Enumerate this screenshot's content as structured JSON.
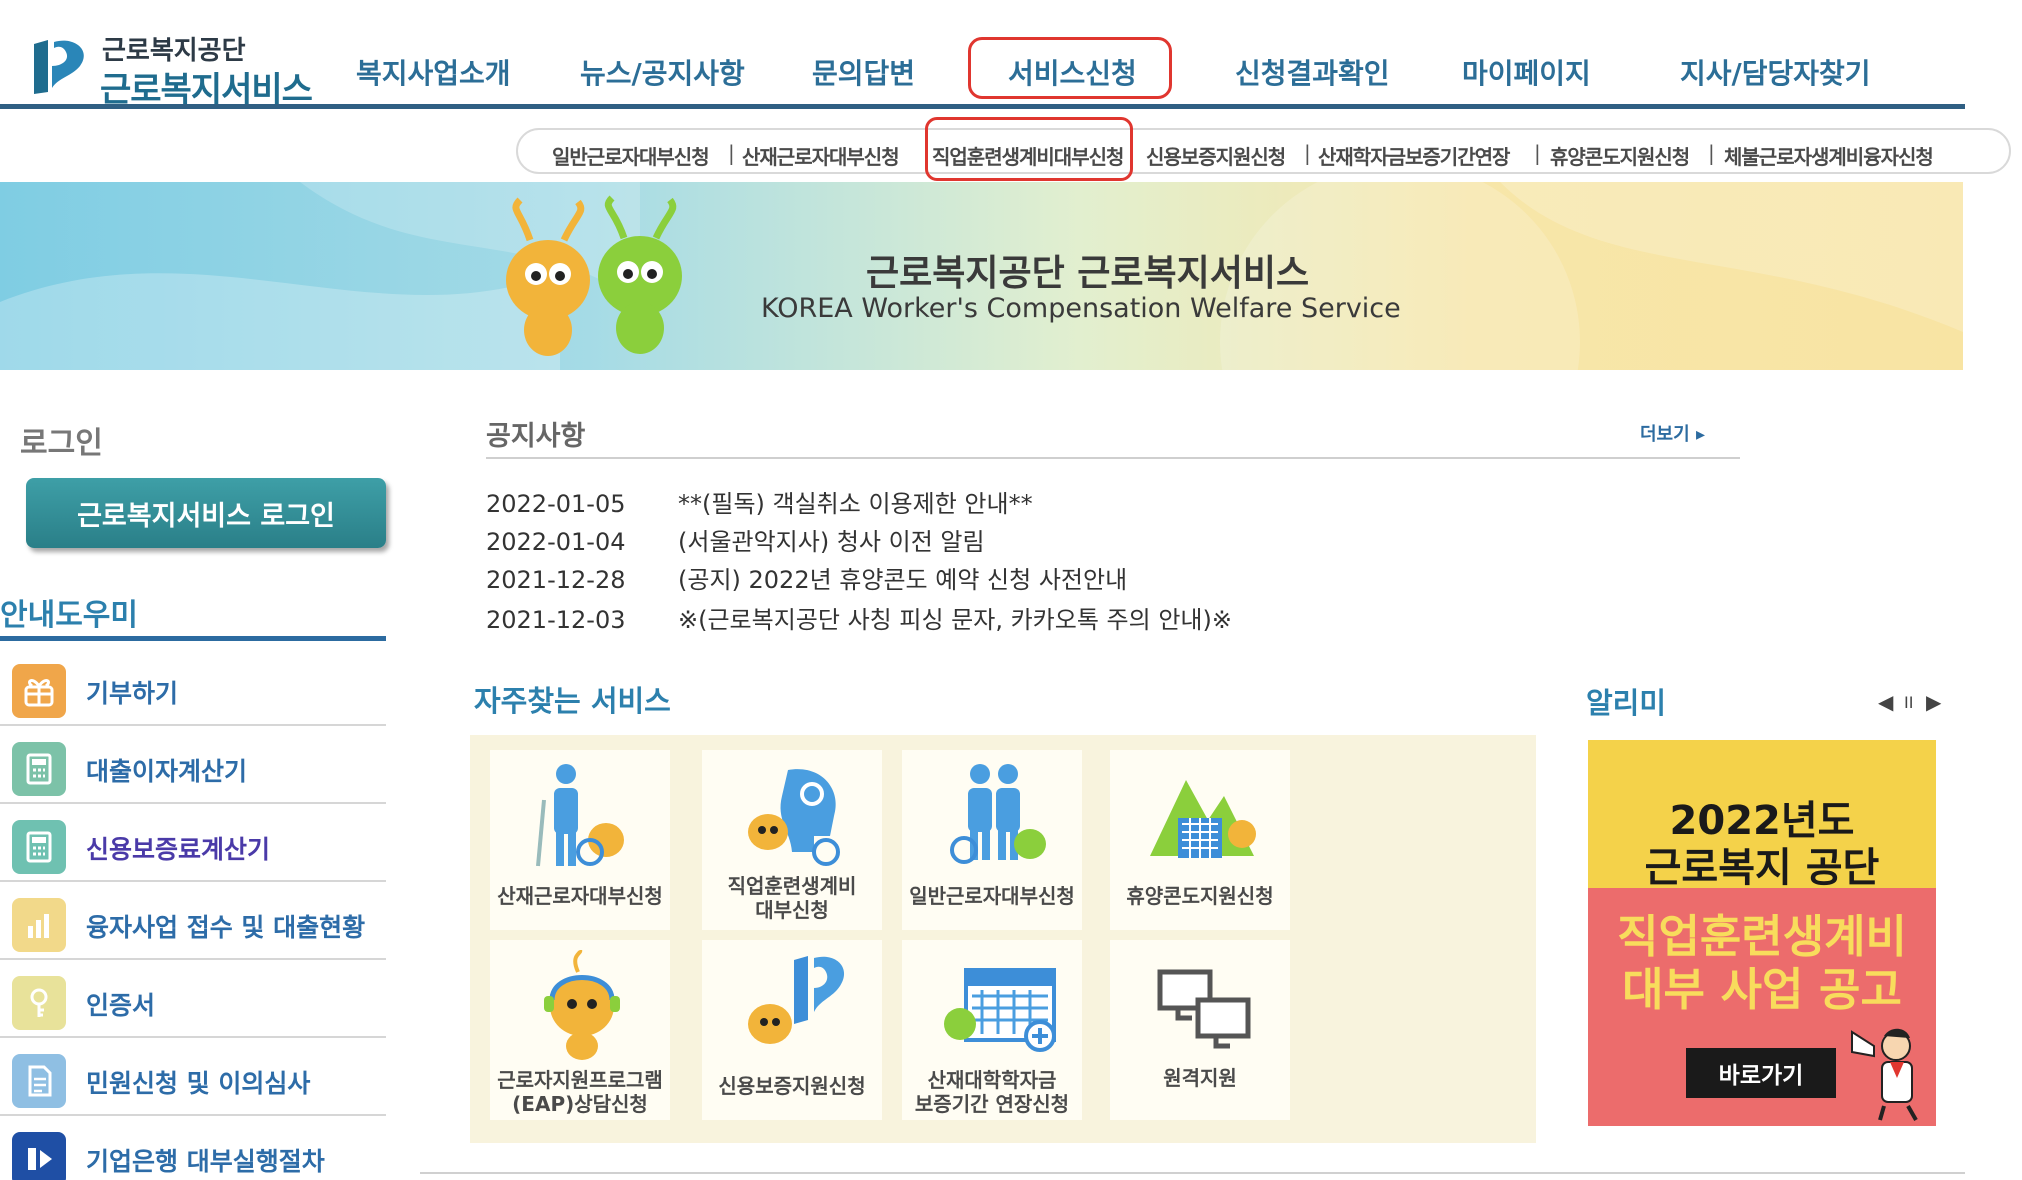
{
  "header": {
    "org_name": "근로복지공단",
    "service_name": "근로복지서비스",
    "nav": [
      {
        "label": "복지사업소개"
      },
      {
        "label": "뉴스/공지사항"
      },
      {
        "label": "문의답변"
      },
      {
        "label": "서비스신청"
      },
      {
        "label": "신청결과확인"
      },
      {
        "label": "마이페이지"
      },
      {
        "label": "지사/담당자찾기"
      }
    ],
    "active_nav": "서비스신청"
  },
  "subnav": {
    "items": [
      {
        "label": "일반근로자대부신청"
      },
      {
        "label": "산재근로자대부신청"
      },
      {
        "label": "직업훈련생계비대부신청"
      },
      {
        "label": "신용보증지원신청"
      },
      {
        "label": "산재학자금보증기간연장"
      },
      {
        "label": "휴양콘도지원신청"
      },
      {
        "label": "체불근로자생계비융자신청"
      }
    ],
    "separator": "|",
    "highlighted": "직업훈련생계비대부신청"
  },
  "banner": {
    "title": "근로복지공단 근로복지서비스",
    "subtitle": "KOREA Worker's Compensation Welfare Service"
  },
  "login": {
    "title": "로그인",
    "button": "근로복지서비스 로그인"
  },
  "guide": {
    "title": "안내도우미",
    "items": [
      {
        "label": "기부하기",
        "icon": "gift-icon",
        "color": "#f0a64a"
      },
      {
        "label": "대출이자계산기",
        "icon": "calculator-icon",
        "color": "#7cc2a8"
      },
      {
        "label": "신용보증료계산기",
        "icon": "calculator-icon",
        "color": "#6fc1b1"
      },
      {
        "label": "융자사업 접수 및 대출현황",
        "icon": "chart-icon",
        "color": "#f2d98a"
      },
      {
        "label": "인증서",
        "icon": "certificate-icon",
        "color": "#e8e29a"
      },
      {
        "label": "민원신청 및 이의심사",
        "icon": "document-icon",
        "color": "#8fbfe3"
      },
      {
        "label": "기업은행 대부실행절차",
        "icon": "ibk-logo-icon",
        "color": "#1f4fa5"
      }
    ]
  },
  "notice": {
    "title": "공지사항",
    "more": "더보기 ▸",
    "rows": [
      {
        "date": "2022-01-05",
        "title": "**(필독) 객실취소 이용제한 안내**"
      },
      {
        "date": "2022-01-04",
        "title": "(서울관악지사) 청사 이전 알림"
      },
      {
        "date": "2021-12-28",
        "title": "(공지) 2022년 휴양콘도 예약 신청 사전안내"
      },
      {
        "date": "2021-12-03",
        "title": "※(근로복지공단 사칭 피싱 문자, 카카오톡 주의 안내)※"
      }
    ]
  },
  "services": {
    "title": "자주찾는 서비스",
    "tiles": [
      {
        "line1": "산재근로자대부신청",
        "line2": "",
        "icon": "injured-worker-icon"
      },
      {
        "line1": "직업훈련생계비",
        "line2": "대부신청",
        "icon": "training-head-icon"
      },
      {
        "line1": "일반근로자대부신청",
        "line2": "",
        "icon": "workers-icon"
      },
      {
        "line1": "휴양콘도지원신청",
        "line2": "",
        "icon": "condo-icon"
      },
      {
        "line1": "근로자지원프로그램",
        "line2": "(EAP)상담신청",
        "icon": "headset-mascot-icon"
      },
      {
        "line1": "신용보증지원신청",
        "line2": "",
        "icon": "credit-guarantee-icon"
      },
      {
        "line1": "산재대학학자금",
        "line2": "보증기간 연장신청",
        "icon": "calendar-icon"
      },
      {
        "line1": "원격지원",
        "line2": "",
        "icon": "remote-monitor-icon"
      }
    ]
  },
  "alimi": {
    "title": "알리미",
    "prev": "◀",
    "pause": "II",
    "next": "▶",
    "year": "2022년도",
    "org": "근로복지 공단",
    "head1": "직업훈련생계비",
    "head2": "대부 사업 공고",
    "button": "바로가기"
  },
  "colors": {
    "brand": "#2c6e97",
    "highlight": "#e0362f",
    "login_button": "#2a7f88"
  }
}
